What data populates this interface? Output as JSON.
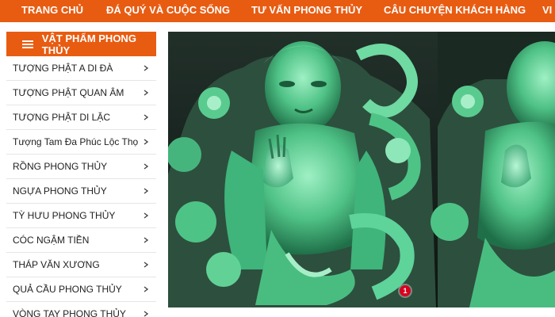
{
  "nav": {
    "items": [
      {
        "label": "TRANG CHỦ"
      },
      {
        "label": "ĐÁ QUÝ VÀ CUỘC SỐNG"
      },
      {
        "label": "TƯ VẤN PHONG THỦY"
      },
      {
        "label": "CÂU CHUYỆN KHÁCH HÀNG"
      },
      {
        "label": "VI"
      }
    ]
  },
  "sidebar": {
    "title": "VẬT PHẨM PHONG THỦY",
    "items": [
      {
        "label": "TƯỢNG PHẬT A DI ĐÀ"
      },
      {
        "label": "TƯỢNG PHẬT QUAN ÂM"
      },
      {
        "label": "TƯỢNG PHẬT DI LẶC"
      },
      {
        "label": "Tượng Tam Đa Phúc Lộc Thọ"
      },
      {
        "label": "RỒNG PHONG THỦY"
      },
      {
        "label": "NGỰA PHONG THỦY"
      },
      {
        "label": "TỲ HƯU PHONG THỦY"
      },
      {
        "label": "CÓC NGẬM TIỀN"
      },
      {
        "label": "THÁP VĂN XƯƠNG"
      },
      {
        "label": "QUẢ CẦU PHONG THỦY"
      },
      {
        "label": "VÒNG TAY PHONG THỦY"
      }
    ]
  },
  "banner": {
    "slide_number": "1"
  },
  "colors": {
    "brand": "#e85c12",
    "jade": "#5fcf9a",
    "dot": "#d8001e"
  }
}
